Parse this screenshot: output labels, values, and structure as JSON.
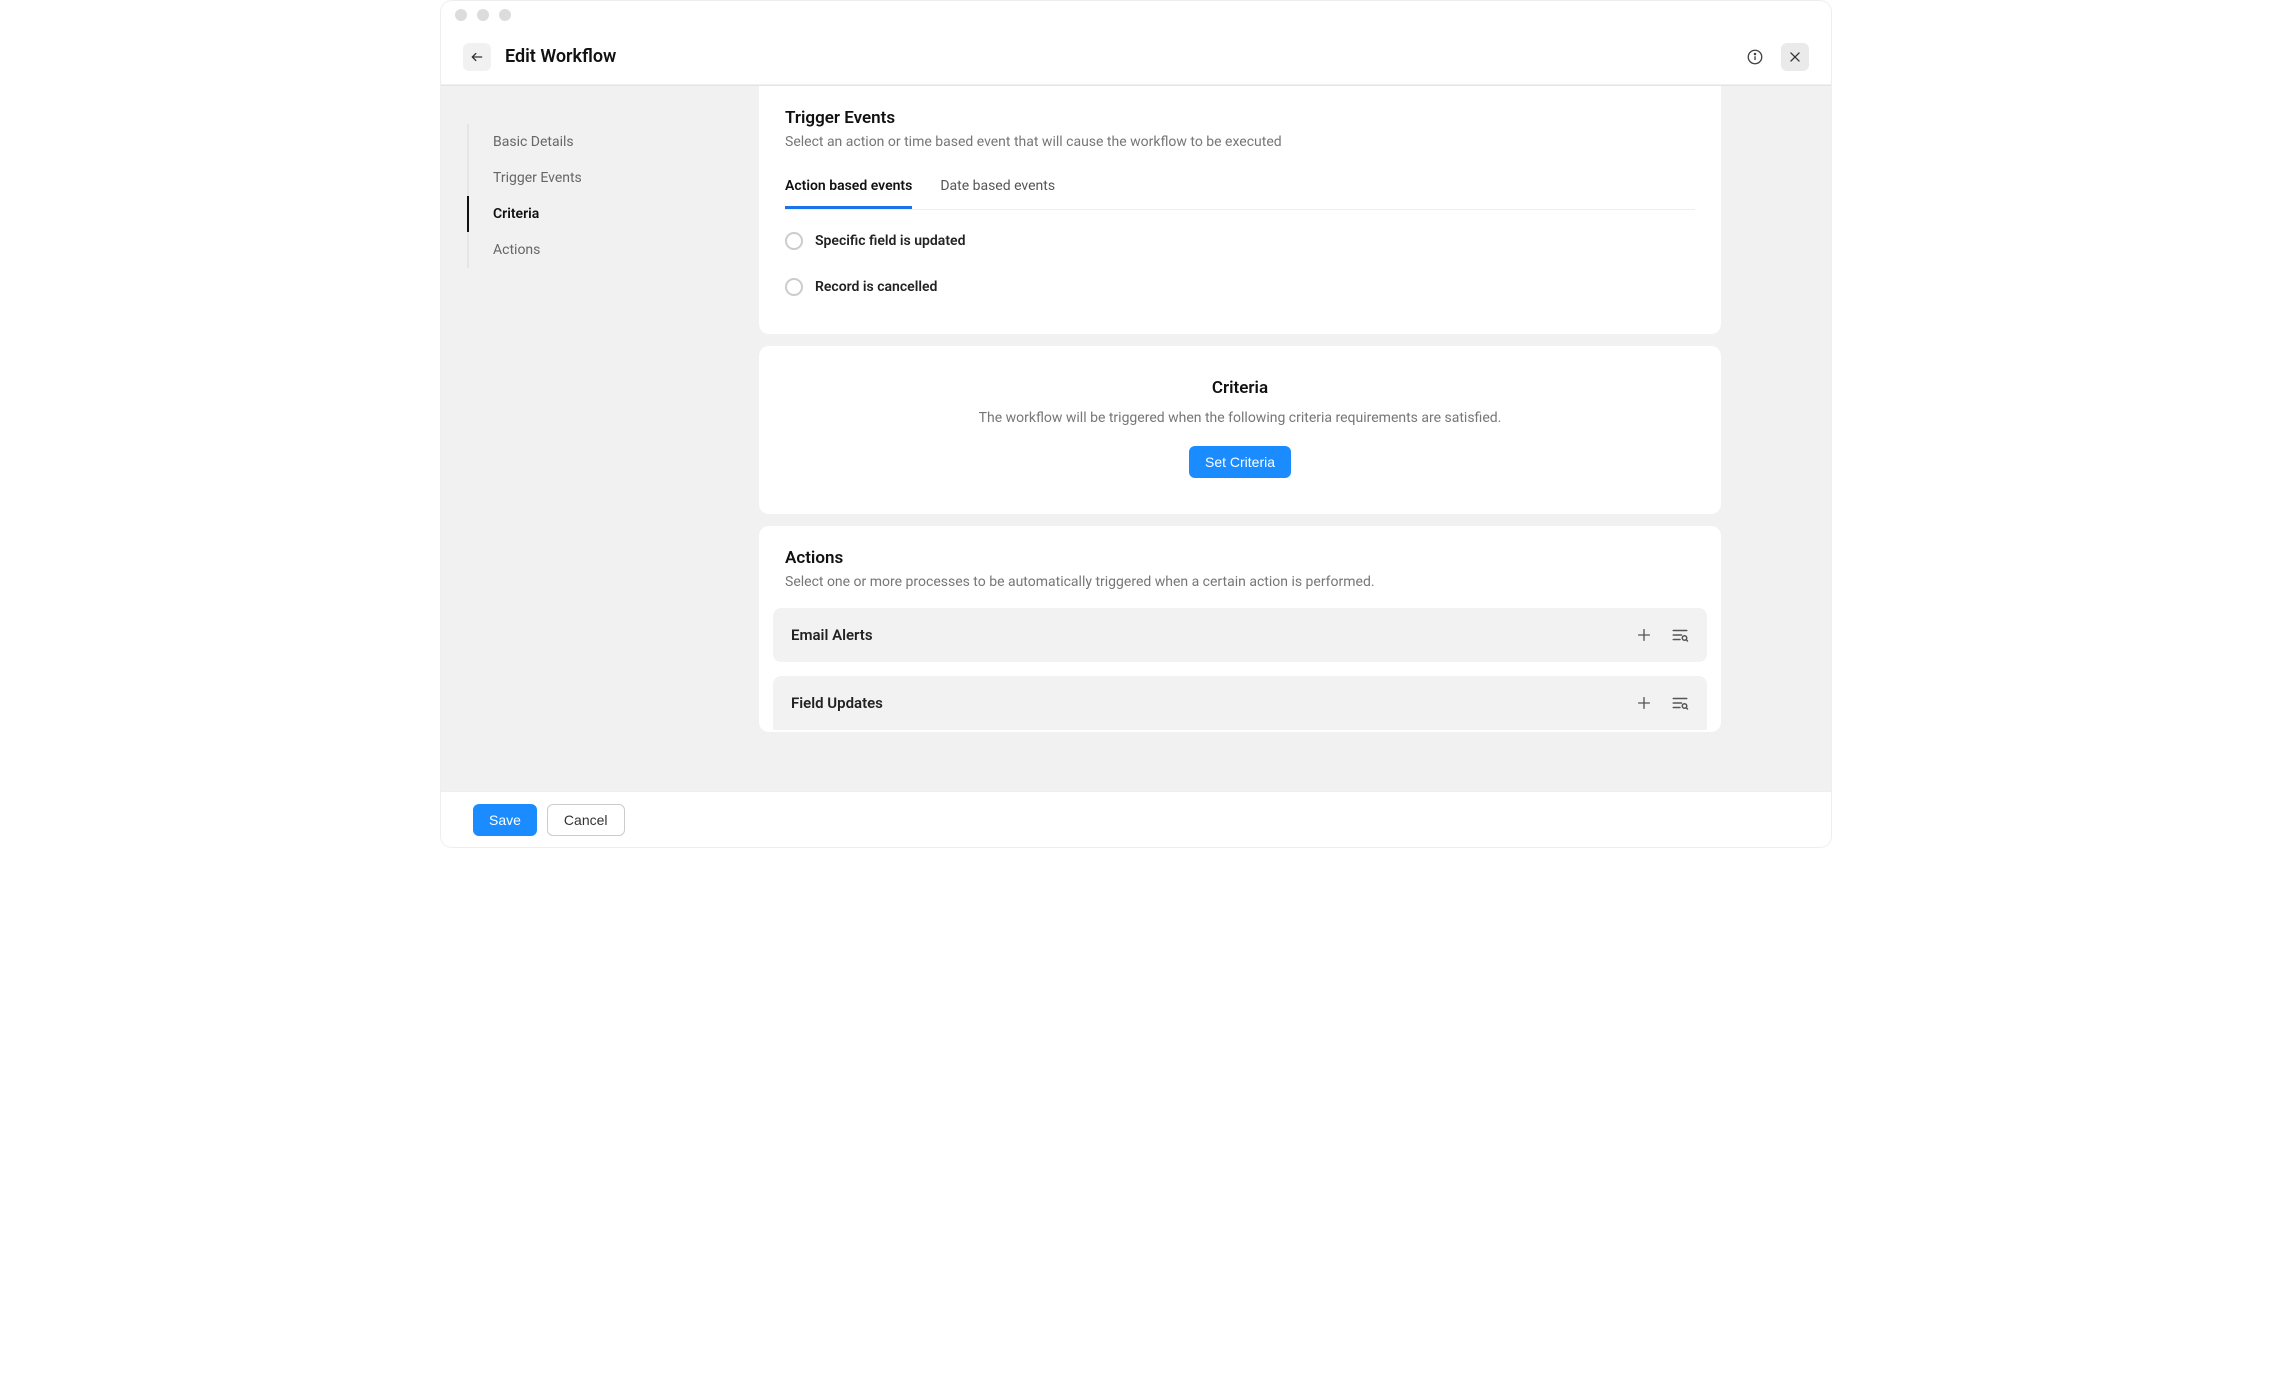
{
  "header": {
    "title": "Edit Workflow"
  },
  "sidebar": {
    "items": [
      {
        "label": "Basic Details"
      },
      {
        "label": "Trigger Events"
      },
      {
        "label": "Criteria"
      },
      {
        "label": "Actions"
      }
    ],
    "active_index": 2
  },
  "trigger_events": {
    "title": "Trigger Events",
    "subtitle": "Select an action or time based event that will cause the workflow to be executed",
    "tabs": [
      {
        "label": "Action based events"
      },
      {
        "label": "Date based events"
      }
    ],
    "active_tab_index": 0,
    "options": [
      {
        "label": "Specific field is updated"
      },
      {
        "label": "Record is cancelled"
      }
    ]
  },
  "criteria": {
    "title": "Criteria",
    "description": "The workflow will be triggered when the following criteria requirements are satisfied.",
    "button_label": "Set Criteria"
  },
  "actions": {
    "title": "Actions",
    "subtitle": "Select one or more processes to be automatically triggered when a certain action is performed.",
    "blocks": [
      {
        "label": "Email Alerts"
      },
      {
        "label": "Field Updates"
      }
    ]
  },
  "footer": {
    "save_label": "Save",
    "cancel_label": "Cancel"
  }
}
